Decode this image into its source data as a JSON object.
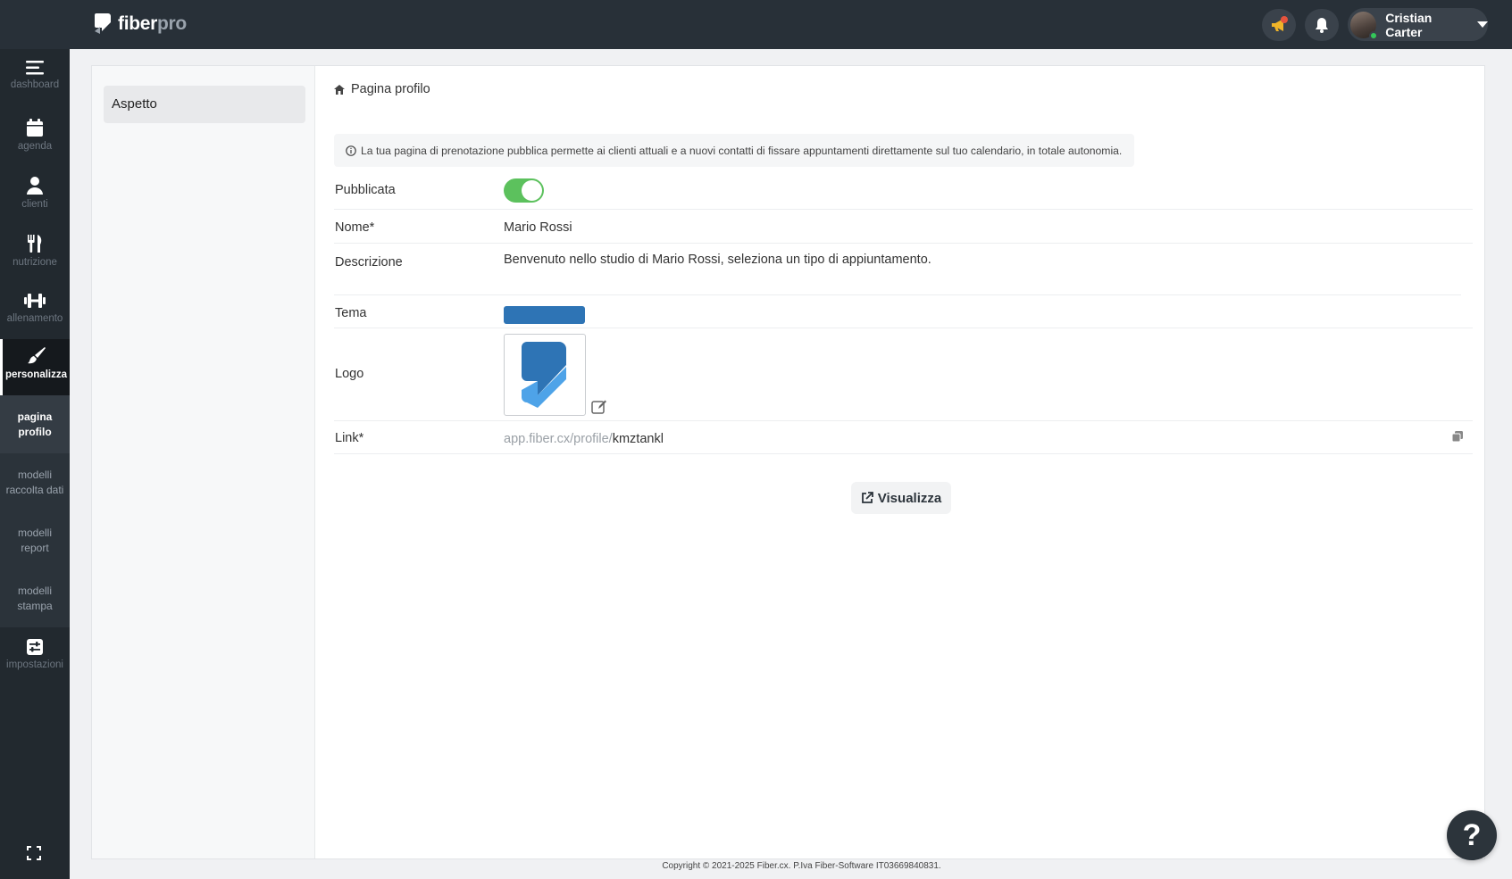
{
  "brand": {
    "fiber": "fiber",
    "pro": "pro"
  },
  "topbar": {
    "user_name": "Cristian Carter"
  },
  "sidebar": {
    "items": [
      {
        "label": "dashboard",
        "icon": "menu-icon"
      },
      {
        "label": "agenda",
        "icon": "calendar-icon"
      },
      {
        "label": "clienti",
        "icon": "user-icon"
      },
      {
        "label": "nutrizione",
        "icon": "utensils-icon"
      },
      {
        "label": "allenamento",
        "icon": "dumbbell-icon"
      },
      {
        "label": "personalizza",
        "icon": "brush-icon"
      },
      {
        "label": "impostazioni",
        "icon": "sliders-icon"
      }
    ],
    "subitems": [
      {
        "l1": "pagina",
        "l2": "profilo"
      },
      {
        "l1": "modelli",
        "l2": "raccolta dati"
      },
      {
        "l1": "modelli",
        "l2": "report"
      },
      {
        "l1": "modelli",
        "l2": "stampa"
      }
    ]
  },
  "left_tabs": {
    "aspetto": "Aspetto"
  },
  "section": {
    "title": "Pagina profilo"
  },
  "info": {
    "text": "La tua pagina di prenotazione pubblica permette ai clienti attuali e a nuovi contatti di fissare appuntamenti direttamente sul tuo calendario, in totale autonomia."
  },
  "form": {
    "published_label": "Pubblicata",
    "published": true,
    "name_label": "Nome*",
    "name_value": "Mario Rossi",
    "description_label": "Descrizione",
    "description_value": "Benvenuto nello studio di Mario Rossi, seleziona un tipo di appiuntamento.",
    "theme_label": "Tema",
    "theme_color": "#2e74b5",
    "logo_label": "Logo",
    "link_label": "Link*",
    "link_prefix": "app.fiber.cx/profile/",
    "link_slug": "kmztankl"
  },
  "actions": {
    "view_label": "Visualizza"
  },
  "footer": {
    "copyright": "Copyright © 2021-2025 Fiber.cx. P.Iva Fiber-Software IT03669840831."
  },
  "help": {
    "label": "?"
  }
}
